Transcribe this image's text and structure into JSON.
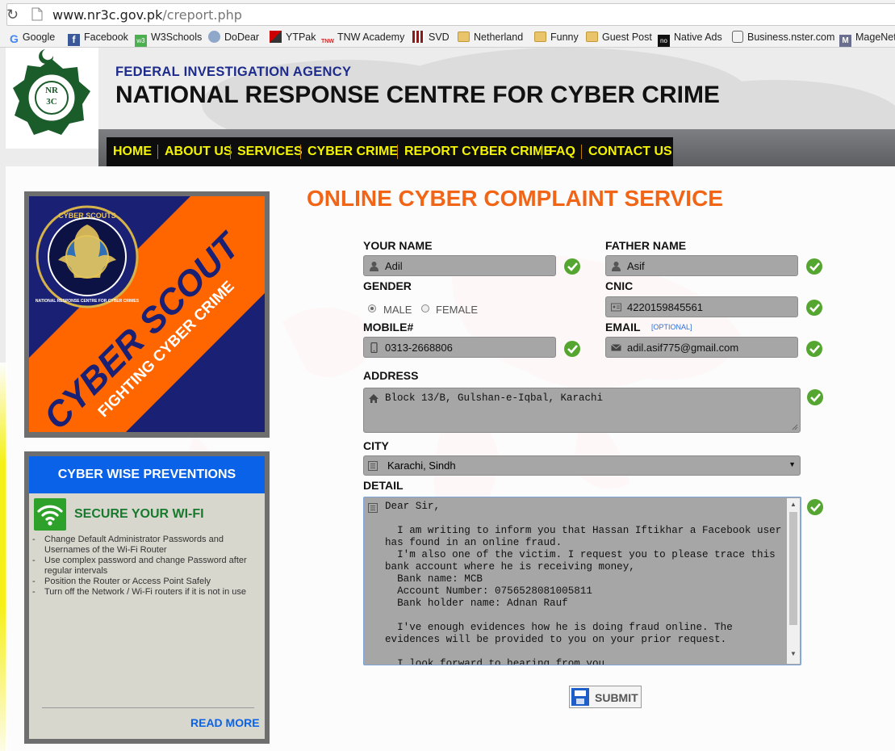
{
  "browser": {
    "url_domain": "www.nr3c.gov.pk",
    "url_path": "/creport.php",
    "bookmarks": [
      "Google",
      "Facebook",
      "W3Schools",
      "DoDear",
      "YTPak",
      "TNW Academy",
      "SVD",
      "Netherland",
      "Funny",
      "Guest Post",
      "Native Ads",
      "Business.nster.com",
      "MageNet"
    ]
  },
  "header": {
    "agency": "FEDERAL INVESTIGATION AGENCY",
    "title": "NATIONAL RESPONSE CENTRE FOR CYBER CRIME",
    "logo_text": "NR3C"
  },
  "nav": [
    "HOME",
    "ABOUT US",
    "SERVICES",
    "CYBER CRIME",
    "REPORT CYBER CRIME",
    "FAQ",
    "CONTACT US"
  ],
  "banner": {
    "seal_text": "CYBER SCOUTS",
    "ring_text": "NATIONAL RESPONSE CENTRE FOR CYBER CRIMES",
    "stripe_main": "CYBER SCOUT",
    "stripe_sub": "FIGHTING CYBER CRIME"
  },
  "preventions": {
    "title": "CYBER WISE PREVENTIONS",
    "heading": "SECURE YOUR WI-FI",
    "items": [
      "Change Default Administrator Passwords and Usernames of the Wi-Fi Router",
      "Use complex password and change Password after regular intervals",
      "Position the Router or Access Point Safely",
      "Turn off the Network / Wi-Fi routers if it is not in use"
    ],
    "read_more": "READ MORE"
  },
  "form": {
    "title": "ONLINE CYBER COMPLAINT SERVICE",
    "name_label": "YOUR NAME",
    "name_value": "Adil",
    "father_label": "FATHER NAME",
    "father_value": "Asif",
    "gender_label": "GENDER",
    "gender_male": "MALE",
    "gender_female": "FEMALE",
    "gender_selected": "MALE",
    "cnic_label": "CNIC",
    "cnic_value": "4220159845561",
    "mobile_label": "MOBILE#",
    "mobile_value": "0313-2668806",
    "email_label": "EMAIL",
    "email_optional": "[OPTIONAL]",
    "email_value": "adil.asif775@gmail.com",
    "address_label": "ADDRESS",
    "address_value": "Block 13/B, Gulshan-e-Iqbal, Karachi",
    "city_label": "CITY",
    "city_value": "Karachi, Sindh",
    "detail_label": "DETAIL",
    "detail_value": "Dear Sir,\n\n  I am writing to inform you that Hassan Iftikhar a Facebook user has found in an online fraud.\n  I'm also one of the victim. I request you to please trace this bank account where he is receiving money,\n  Bank name: MCB\n  Account Number: 0756528081005811\n  Bank holder name: Adnan Rauf\n\n  I've enough evidences how he is doing fraud online. The evidences will be provided to you on your prior request.\n\n  I look forward to hearing from you.",
    "submit": "SUBMIT"
  },
  "colors": {
    "nav_text": "#f4f400",
    "form_title": "#f26516",
    "agency_blue": "#1d2c8c",
    "check_green": "#55a630",
    "preventions_blue": "#0a62e8"
  }
}
